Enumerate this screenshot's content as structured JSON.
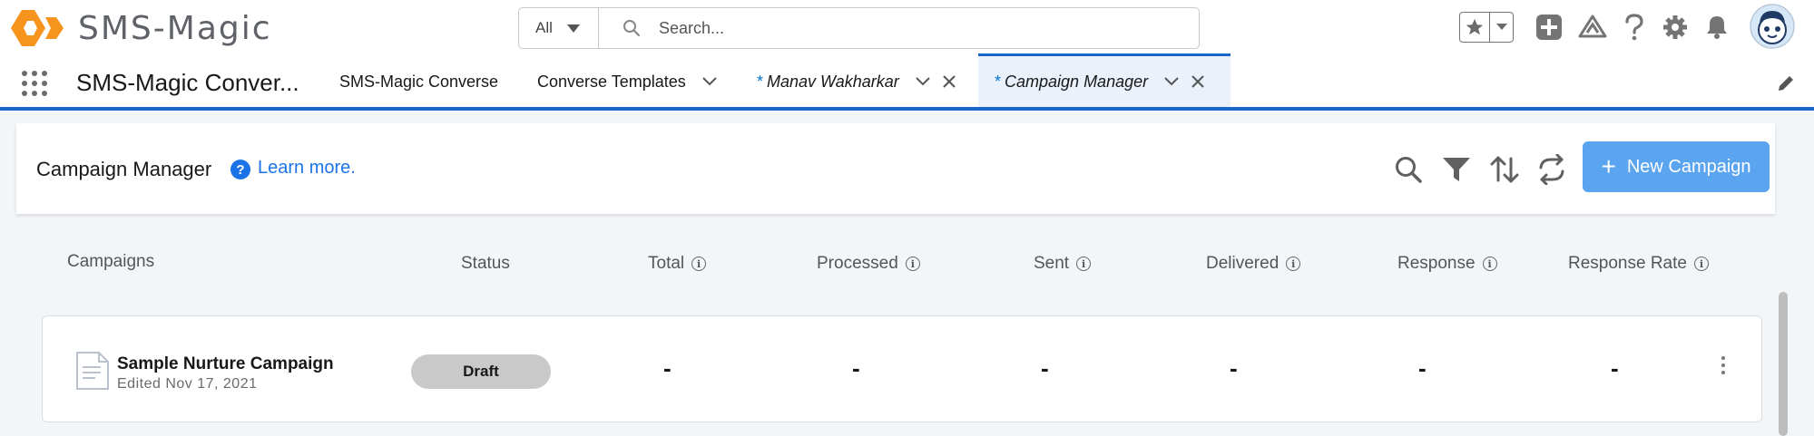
{
  "header": {
    "logo_text": "SMS-Magic",
    "logo_color": "#f7941d",
    "search_scope": "All",
    "search_placeholder": "Search...",
    "utility_icons": [
      "favorites-star-icon",
      "add-icon",
      "trailhead-icon",
      "help-icon",
      "setup-gear-icon",
      "notifications-bell-icon",
      "avatar"
    ]
  },
  "nav": {
    "app_name": "SMS-Magic Conver...",
    "items": [
      {
        "label": "SMS-Magic Converse"
      },
      {
        "label": "Converse Templates"
      },
      {
        "label": "Manav Wakharkar",
        "prefix": "*"
      },
      {
        "label": "Campaign Manager",
        "prefix": "*",
        "active": true
      }
    ]
  },
  "page": {
    "title": "Campaign Manager",
    "help_badge": "?",
    "learn_more": "Learn more.",
    "new_button": "New Campaign",
    "action_icons": [
      "search-icon",
      "filter-icon",
      "sort-icon",
      "refresh-icon"
    ]
  },
  "table": {
    "columns": [
      "Campaigns",
      "Status",
      "Total",
      "Processed",
      "Sent",
      "Delivered",
      "Response",
      "Response Rate"
    ],
    "info_glyph": "i",
    "rows": [
      {
        "name": "Sample Nurture Campaign",
        "edited": "Edited Nov 17, 2021",
        "status": "Draft",
        "total": "-",
        "processed": "-",
        "sent": "-",
        "delivered": "-",
        "response": "-",
        "response_rate": "-"
      }
    ]
  },
  "colors": {
    "accent": "#1b66c9",
    "button": "#5aa4f0",
    "link": "#1b73e8",
    "status_pill": "#c9c9c9"
  }
}
